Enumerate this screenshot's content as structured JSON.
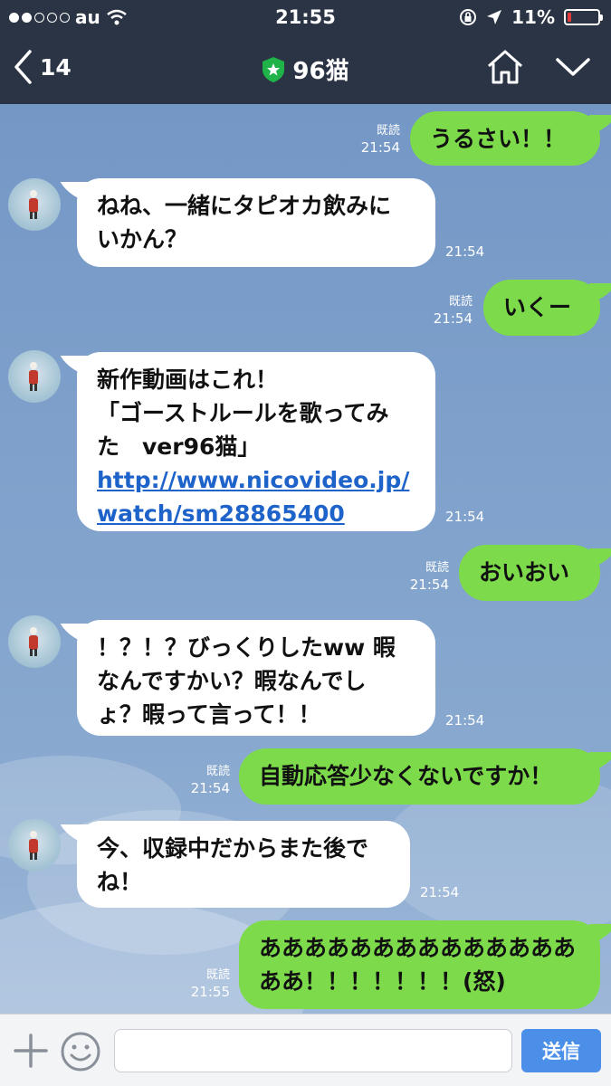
{
  "status_bar": {
    "carrier": "au",
    "time": "21:55",
    "battery": "11%",
    "battery_level": 0.11,
    "signal_bars_filled": 2
  },
  "nav": {
    "back_count": "14",
    "title": "96猫",
    "icons": [
      "chevron-left-icon",
      "official-star-badge-icon",
      "home-icon",
      "chevron-down-icon"
    ]
  },
  "messages": [
    {
      "side": "out",
      "text": "うるさい！！",
      "read": "既読",
      "time": "21:54"
    },
    {
      "side": "in",
      "lines": [
        "ねね、一緒にタピオカ飲みに",
        "いかん？"
      ],
      "time": "21:54"
    },
    {
      "side": "out",
      "text": "いくー",
      "read": "既読",
      "time": "21:54"
    },
    {
      "side": "in",
      "lines": [
        "新作動画はこれ！",
        "「ゴーストルールを歌ってみ",
        "た　ver96猫」"
      ],
      "link_lines": [
        "http://www.nicovideo.jp/",
        "watch/sm28865400"
      ],
      "time": "21:54"
    },
    {
      "side": "out",
      "text": "おいおい",
      "read": "既読",
      "time": "21:54"
    },
    {
      "side": "in",
      "lines": [
        "！？！？びっくりしたww 暇",
        "なんですかい？暇なんでし",
        "ょ？暇って言って！！"
      ],
      "time": "21:54"
    },
    {
      "side": "out",
      "text": "自動応答少なくないですか！",
      "read": "既読",
      "time": "21:54"
    },
    {
      "side": "in",
      "lines": [
        "今、収録中だからまた後で",
        "ね！"
      ],
      "time": "21:54"
    },
    {
      "side": "out",
      "lines": [
        "ああああああああああああああ",
        "ああ！！！！！！！(怒)"
      ],
      "read": "既読",
      "time": "21:55"
    }
  ],
  "input_bar": {
    "send_label": "送信",
    "placeholder": "",
    "colors": {
      "send": "#4b8fe8",
      "out_bubble": "#7ddb4b"
    }
  }
}
